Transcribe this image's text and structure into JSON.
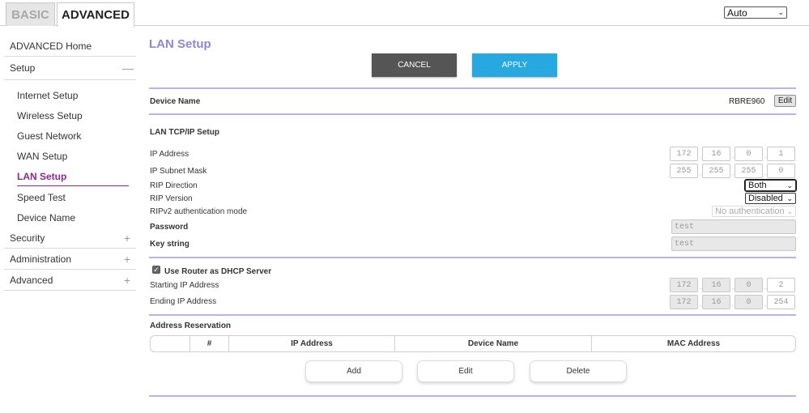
{
  "tabs": {
    "basic": "BASIC",
    "advanced": "ADVANCED"
  },
  "language": {
    "selected": "Auto"
  },
  "sidebar": {
    "home": "ADVANCED Home",
    "setup": "Setup",
    "setup_items": [
      "Internet Setup",
      "Wireless Setup",
      "Guest Network",
      "WAN Setup",
      "LAN Setup",
      "Speed Test",
      "Device Name"
    ],
    "security": "Security",
    "administration": "Administration",
    "advanced": "Advanced",
    "active_item": "LAN Setup"
  },
  "page": {
    "title": "LAN Setup",
    "cancel_label": "CANCEL",
    "apply_label": "APPLY"
  },
  "device": {
    "label": "Device Name",
    "value": "RBRE960",
    "edit_label": "Edit"
  },
  "lan": {
    "section_title": "LAN TCP/IP Setup",
    "ip_label": "IP Address",
    "ip": [
      "172",
      "16",
      "0",
      "1"
    ],
    "mask_label": "IP Subnet Mask",
    "mask": [
      "255",
      "255",
      "255",
      "0"
    ],
    "rip_direction_label": "RIP Direction",
    "rip_direction": "Both",
    "rip_version_label": "RIP Version",
    "rip_version": "Disabled",
    "ripv2_auth_label": "RIPv2 authentication mode",
    "ripv2_auth": "No authentication",
    "password_label": "Password",
    "password_value": "test",
    "key_label": "Key string",
    "key_value": "test"
  },
  "dhcp": {
    "checkbox_label": "Use Router as DHCP Server",
    "checked": true,
    "start_label": "Starting IP Address",
    "start": [
      "172",
      "16",
      "0",
      "2"
    ],
    "end_label": "Ending IP Address",
    "end": [
      "172",
      "16",
      "0",
      "254"
    ]
  },
  "reservation": {
    "title": "Address Reservation",
    "columns": [
      "",
      "#",
      "IP Address",
      "Device Name",
      "MAC Address"
    ],
    "add_label": "Add",
    "edit_label": "Edit",
    "delete_label": "Delete"
  },
  "colors": {
    "accent": "#8e87d8",
    "divider": "#b7b3ec",
    "apply": "#27a8e0",
    "cancel": "#555555",
    "active_nav": "#8a2a8c"
  }
}
